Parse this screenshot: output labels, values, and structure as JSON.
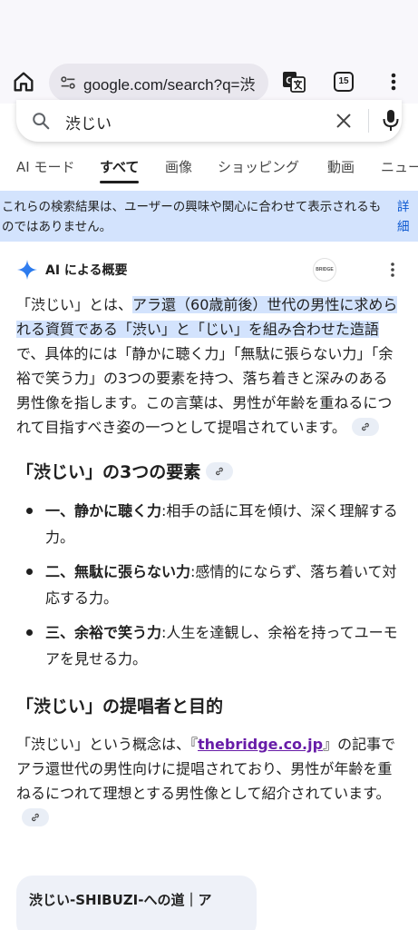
{
  "browser": {
    "url": "google.com/search?q=渋",
    "tab_count": "15",
    "icons": {
      "home": "home-icon",
      "site_info": "tune-icon",
      "translate": "translate-icon",
      "menu": "more-vert-icon"
    }
  },
  "search": {
    "query": "渋じい",
    "icons": {
      "search": "search-icon",
      "clear": "close-icon",
      "mic": "mic-icon"
    }
  },
  "tabs": [
    {
      "label": "AI モード",
      "active": false
    },
    {
      "label": "すべて",
      "active": true
    },
    {
      "label": "画像",
      "active": false
    },
    {
      "label": "ショッピング",
      "active": false
    },
    {
      "label": "動画",
      "active": false
    },
    {
      "label": "ニュー",
      "active": false
    }
  ],
  "notice": {
    "text": "これらの検索結果は、ユーザーの興味や関心に合わせて表示されるものではありません。",
    "link": "詳細"
  },
  "ai_overview": {
    "title": "AI による概要",
    "source_logo_text": "BRIDGE",
    "intro": {
      "before": "「渋じい」とは、",
      "highlight": "アラ還（60歳前後）世代の男性に求められる資質である「渋い」と「じい」を組み合わせた造語",
      "after": "で、具体的には「静かに聴く力」「無駄に張らない力」「余裕で笑う力」の3つの要素を持つ、落ち着きと深みのある男性像を指します。この言葉は、男性が年齢を重ねるにつれて目指すべき姿の一つとして提唱されています。"
    },
    "section1": {
      "heading": "「渋じい」の3つの要素",
      "items": [
        {
          "bold": "一、静かに聴く力",
          "text": ":相手の話に耳を傾け、深く理解する力。"
        },
        {
          "bold": "二、無駄に張らない力",
          "text": ":感情的にならず、落ち着いて対応する力。"
        },
        {
          "bold": "三、余裕で笑う力",
          "text": ":人生を達観し、余裕を持ってユーモアを見せる力。"
        }
      ]
    },
    "section2": {
      "heading": "「渋じい」の提唱者と目的",
      "before": "「渋じい」という概念は、『",
      "link": "thebridge.co.jp",
      "after": "』の記事でアラ還世代の男性向けに提唱されており、男性が年齢を重ねるにつれて理想とする男性像として紹介されています。"
    }
  },
  "card": {
    "title": "渋じい-SHIBUZI-への道｜ア"
  },
  "colors": {
    "highlight": "#d3e3fd",
    "notice_bg": "#d3e3fd",
    "link_blue": "#0b57d0",
    "visited_link": "#681da8",
    "sparkle": "#4285f4"
  }
}
